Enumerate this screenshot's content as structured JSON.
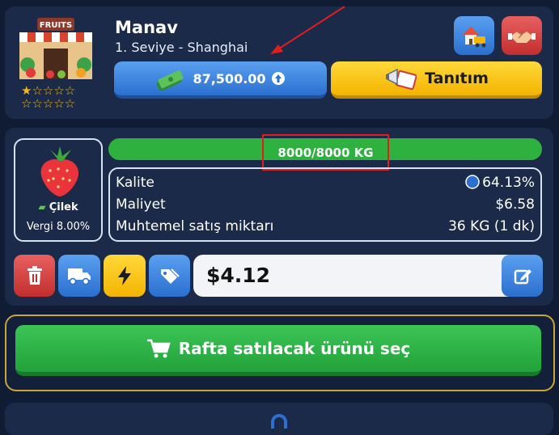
{
  "shop": {
    "name": "Manav",
    "level": "1. Seviye - Shanghai",
    "sign_text": "FRUITS",
    "stars_filled": 1,
    "stars_total": 10
  },
  "money": {
    "value": "87,500.00"
  },
  "promo": {
    "label": "Tanıtım"
  },
  "product": {
    "name": "Çilek",
    "tax": "Vergi 8.00%",
    "stock": "8000/8000 KG",
    "stock_fill": 1.0
  },
  "stats": [
    {
      "label": "Kalite",
      "value": "64.13%"
    },
    {
      "label": "Maliyet",
      "value": "$6.58"
    },
    {
      "label": "Muhtemel satış miktarı",
      "value": "36 KG (1 dk)"
    }
  ],
  "price": {
    "value": "$4.12"
  },
  "select": {
    "label": "Rafta satılacak ürünü seç"
  },
  "colors": {
    "background": "#101c33",
    "panel": "#1a2a48",
    "blue": "#2b6fcf",
    "yellow": "#f4b400",
    "green": "#2eb13e",
    "red": "#d33a3a"
  }
}
